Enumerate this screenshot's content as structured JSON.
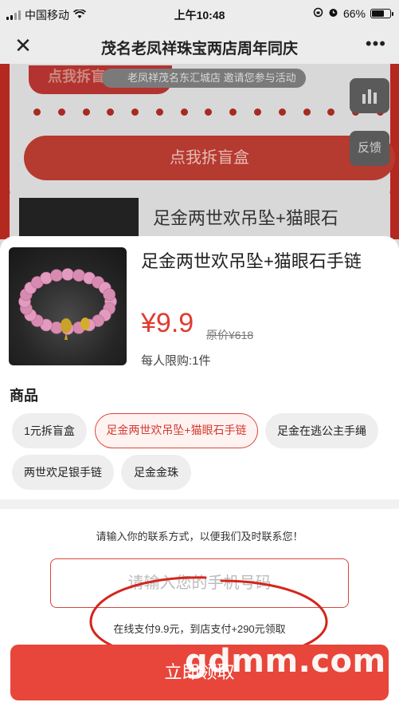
{
  "status_bar": {
    "carrier": "中国移动",
    "time": "上午10:48",
    "battery": "66%",
    "battery_level": 0.66
  },
  "navbar": {
    "close_glyph": "✕",
    "title": "茂名老凤祥珠宝两店周年同庆",
    "more_glyph": "•••"
  },
  "background_page": {
    "chai_label": "点我拆盲",
    "invite_text": "老凤祥茂名东汇城店 邀请您参与活动",
    "chai_button": "点我拆盲盒",
    "product_peek": "足金两世欢吊坠+猫眼石",
    "feedback_label": "反馈"
  },
  "product": {
    "name": "足金两世欢吊坠+猫眼石手链",
    "price": "¥9.9",
    "original_price": "原价¥618",
    "limit": "每人限购:1件"
  },
  "section_title": "商品",
  "chips": [
    {
      "label": "1元拆盲盒",
      "active": false
    },
    {
      "label": "足金两世欢吊坠+猫眼石手链",
      "active": true
    },
    {
      "label": "足金在逃公主手绳",
      "active": false
    },
    {
      "label": "两世欢足银手链",
      "active": false
    },
    {
      "label": "足金金珠",
      "active": false
    }
  ],
  "contact": {
    "hint": "请输入你的联系方式，以便我们及时联系您！",
    "phone_placeholder": "请输入您的手机号码",
    "pay_note": "在线支付9.9元，到店支付+290元领取",
    "submit_label": "立即领取"
  },
  "watermark": "gdmm.com",
  "colors": {
    "accent": "#e8463a",
    "price": "#e03b2f",
    "chip_active_border": "#d9453a"
  }
}
